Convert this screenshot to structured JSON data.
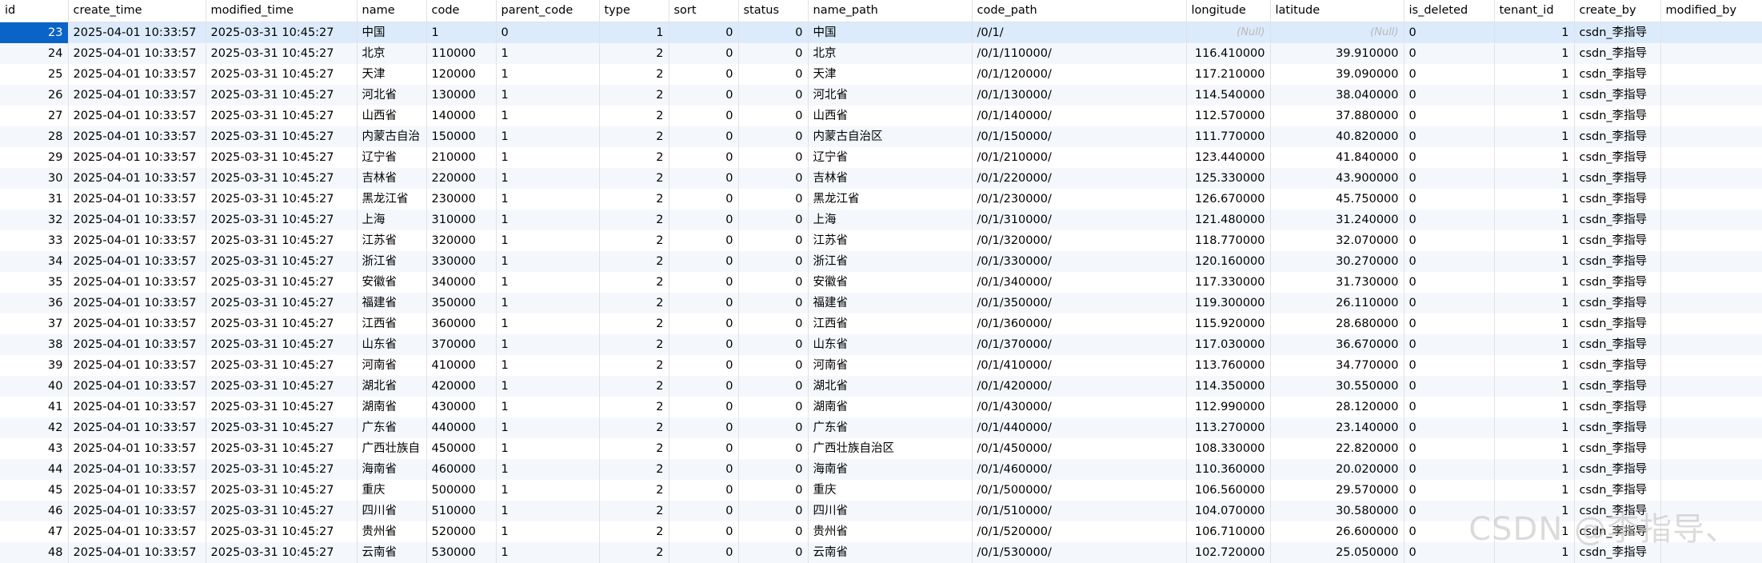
{
  "columns": [
    "id",
    "create_time",
    "modified_time",
    "name",
    "code",
    "parent_code",
    "type",
    "sort",
    "status",
    "name_path",
    "code_path",
    "longitude",
    "latitude",
    "is_deleted",
    "tenant_id",
    "create_by",
    "modified_by"
  ],
  "null_label": "(Null)",
  "rows": [
    [
      "23",
      "2025-04-01 10:33:57",
      "2025-03-31 10:45:27",
      "中国",
      "1",
      "0",
      "1",
      "0",
      "0",
      "中国",
      "/0/1/",
      "(Null)",
      "(Null)",
      "0",
      "1",
      "csdn_李指导",
      ""
    ],
    [
      "24",
      "2025-04-01 10:33:57",
      "2025-03-31 10:45:27",
      "北京",
      "110000",
      "1",
      "2",
      "0",
      "0",
      "北京",
      "/0/1/110000/",
      "116.410000",
      "39.910000",
      "0",
      "1",
      "csdn_李指导",
      ""
    ],
    [
      "25",
      "2025-04-01 10:33:57",
      "2025-03-31 10:45:27",
      "天津",
      "120000",
      "1",
      "2",
      "0",
      "0",
      "天津",
      "/0/1/120000/",
      "117.210000",
      "39.090000",
      "0",
      "1",
      "csdn_李指导",
      ""
    ],
    [
      "26",
      "2025-04-01 10:33:57",
      "2025-03-31 10:45:27",
      "河北省",
      "130000",
      "1",
      "2",
      "0",
      "0",
      "河北省",
      "/0/1/130000/",
      "114.540000",
      "38.040000",
      "0",
      "1",
      "csdn_李指导",
      ""
    ],
    [
      "27",
      "2025-04-01 10:33:57",
      "2025-03-31 10:45:27",
      "山西省",
      "140000",
      "1",
      "2",
      "0",
      "0",
      "山西省",
      "/0/1/140000/",
      "112.570000",
      "37.880000",
      "0",
      "1",
      "csdn_李指导",
      ""
    ],
    [
      "28",
      "2025-04-01 10:33:57",
      "2025-03-31 10:45:27",
      "内蒙古自治",
      "150000",
      "1",
      "2",
      "0",
      "0",
      "内蒙古自治区",
      "/0/1/150000/",
      "111.770000",
      "40.820000",
      "0",
      "1",
      "csdn_李指导",
      ""
    ],
    [
      "29",
      "2025-04-01 10:33:57",
      "2025-03-31 10:45:27",
      "辽宁省",
      "210000",
      "1",
      "2",
      "0",
      "0",
      "辽宁省",
      "/0/1/210000/",
      "123.440000",
      "41.840000",
      "0",
      "1",
      "csdn_李指导",
      ""
    ],
    [
      "30",
      "2025-04-01 10:33:57",
      "2025-03-31 10:45:27",
      "吉林省",
      "220000",
      "1",
      "2",
      "0",
      "0",
      "吉林省",
      "/0/1/220000/",
      "125.330000",
      "43.900000",
      "0",
      "1",
      "csdn_李指导",
      ""
    ],
    [
      "31",
      "2025-04-01 10:33:57",
      "2025-03-31 10:45:27",
      "黑龙江省",
      "230000",
      "1",
      "2",
      "0",
      "0",
      "黑龙江省",
      "/0/1/230000/",
      "126.670000",
      "45.750000",
      "0",
      "1",
      "csdn_李指导",
      ""
    ],
    [
      "32",
      "2025-04-01 10:33:57",
      "2025-03-31 10:45:27",
      "上海",
      "310000",
      "1",
      "2",
      "0",
      "0",
      "上海",
      "/0/1/310000/",
      "121.480000",
      "31.240000",
      "0",
      "1",
      "csdn_李指导",
      ""
    ],
    [
      "33",
      "2025-04-01 10:33:57",
      "2025-03-31 10:45:27",
      "江苏省",
      "320000",
      "1",
      "2",
      "0",
      "0",
      "江苏省",
      "/0/1/320000/",
      "118.770000",
      "32.070000",
      "0",
      "1",
      "csdn_李指导",
      ""
    ],
    [
      "34",
      "2025-04-01 10:33:57",
      "2025-03-31 10:45:27",
      "浙江省",
      "330000",
      "1",
      "2",
      "0",
      "0",
      "浙江省",
      "/0/1/330000/",
      "120.160000",
      "30.270000",
      "0",
      "1",
      "csdn_李指导",
      ""
    ],
    [
      "35",
      "2025-04-01 10:33:57",
      "2025-03-31 10:45:27",
      "安徽省",
      "340000",
      "1",
      "2",
      "0",
      "0",
      "安徽省",
      "/0/1/340000/",
      "117.330000",
      "31.730000",
      "0",
      "1",
      "csdn_李指导",
      ""
    ],
    [
      "36",
      "2025-04-01 10:33:57",
      "2025-03-31 10:45:27",
      "福建省",
      "350000",
      "1",
      "2",
      "0",
      "0",
      "福建省",
      "/0/1/350000/",
      "119.300000",
      "26.110000",
      "0",
      "1",
      "csdn_李指导",
      ""
    ],
    [
      "37",
      "2025-04-01 10:33:57",
      "2025-03-31 10:45:27",
      "江西省",
      "360000",
      "1",
      "2",
      "0",
      "0",
      "江西省",
      "/0/1/360000/",
      "115.920000",
      "28.680000",
      "0",
      "1",
      "csdn_李指导",
      ""
    ],
    [
      "38",
      "2025-04-01 10:33:57",
      "2025-03-31 10:45:27",
      "山东省",
      "370000",
      "1",
      "2",
      "0",
      "0",
      "山东省",
      "/0/1/370000/",
      "117.030000",
      "36.670000",
      "0",
      "1",
      "csdn_李指导",
      ""
    ],
    [
      "39",
      "2025-04-01 10:33:57",
      "2025-03-31 10:45:27",
      "河南省",
      "410000",
      "1",
      "2",
      "0",
      "0",
      "河南省",
      "/0/1/410000/",
      "113.760000",
      "34.770000",
      "0",
      "1",
      "csdn_李指导",
      ""
    ],
    [
      "40",
      "2025-04-01 10:33:57",
      "2025-03-31 10:45:27",
      "湖北省",
      "420000",
      "1",
      "2",
      "0",
      "0",
      "湖北省",
      "/0/1/420000/",
      "114.350000",
      "30.550000",
      "0",
      "1",
      "csdn_李指导",
      ""
    ],
    [
      "41",
      "2025-04-01 10:33:57",
      "2025-03-31 10:45:27",
      "湖南省",
      "430000",
      "1",
      "2",
      "0",
      "0",
      "湖南省",
      "/0/1/430000/",
      "112.990000",
      "28.120000",
      "0",
      "1",
      "csdn_李指导",
      ""
    ],
    [
      "42",
      "2025-04-01 10:33:57",
      "2025-03-31 10:45:27",
      "广东省",
      "440000",
      "1",
      "2",
      "0",
      "0",
      "广东省",
      "/0/1/440000/",
      "113.270000",
      "23.140000",
      "0",
      "1",
      "csdn_李指导",
      ""
    ],
    [
      "43",
      "2025-04-01 10:33:57",
      "2025-03-31 10:45:27",
      "广西壮族自",
      "450000",
      "1",
      "2",
      "0",
      "0",
      "广西壮族自治区",
      "/0/1/450000/",
      "108.330000",
      "22.820000",
      "0",
      "1",
      "csdn_李指导",
      ""
    ],
    [
      "44",
      "2025-04-01 10:33:57",
      "2025-03-31 10:45:27",
      "海南省",
      "460000",
      "1",
      "2",
      "0",
      "0",
      "海南省",
      "/0/1/460000/",
      "110.360000",
      "20.020000",
      "0",
      "1",
      "csdn_李指导",
      ""
    ],
    [
      "45",
      "2025-04-01 10:33:57",
      "2025-03-31 10:45:27",
      "重庆",
      "500000",
      "1",
      "2",
      "0",
      "0",
      "重庆",
      "/0/1/500000/",
      "106.560000",
      "29.570000",
      "0",
      "1",
      "csdn_李指导",
      ""
    ],
    [
      "46",
      "2025-04-01 10:33:57",
      "2025-03-31 10:45:27",
      "四川省",
      "510000",
      "1",
      "2",
      "0",
      "0",
      "四川省",
      "/0/1/510000/",
      "104.070000",
      "30.580000",
      "0",
      "1",
      "csdn_李指导",
      ""
    ],
    [
      "47",
      "2025-04-01 10:33:57",
      "2025-03-31 10:45:27",
      "贵州省",
      "520000",
      "1",
      "2",
      "0",
      "0",
      "贵州省",
      "/0/1/520000/",
      "106.710000",
      "26.600000",
      "0",
      "1",
      "csdn_李指导",
      ""
    ],
    [
      "48",
      "2025-04-01 10:33:57",
      "2025-03-31 10:45:27",
      "云南省",
      "530000",
      "1",
      "2",
      "0",
      "0",
      "云南省",
      "/0/1/530000/",
      "102.720000",
      "25.050000",
      "0",
      "1",
      "csdn_李指导",
      ""
    ]
  ],
  "watermark": "CSDN @李指导、"
}
